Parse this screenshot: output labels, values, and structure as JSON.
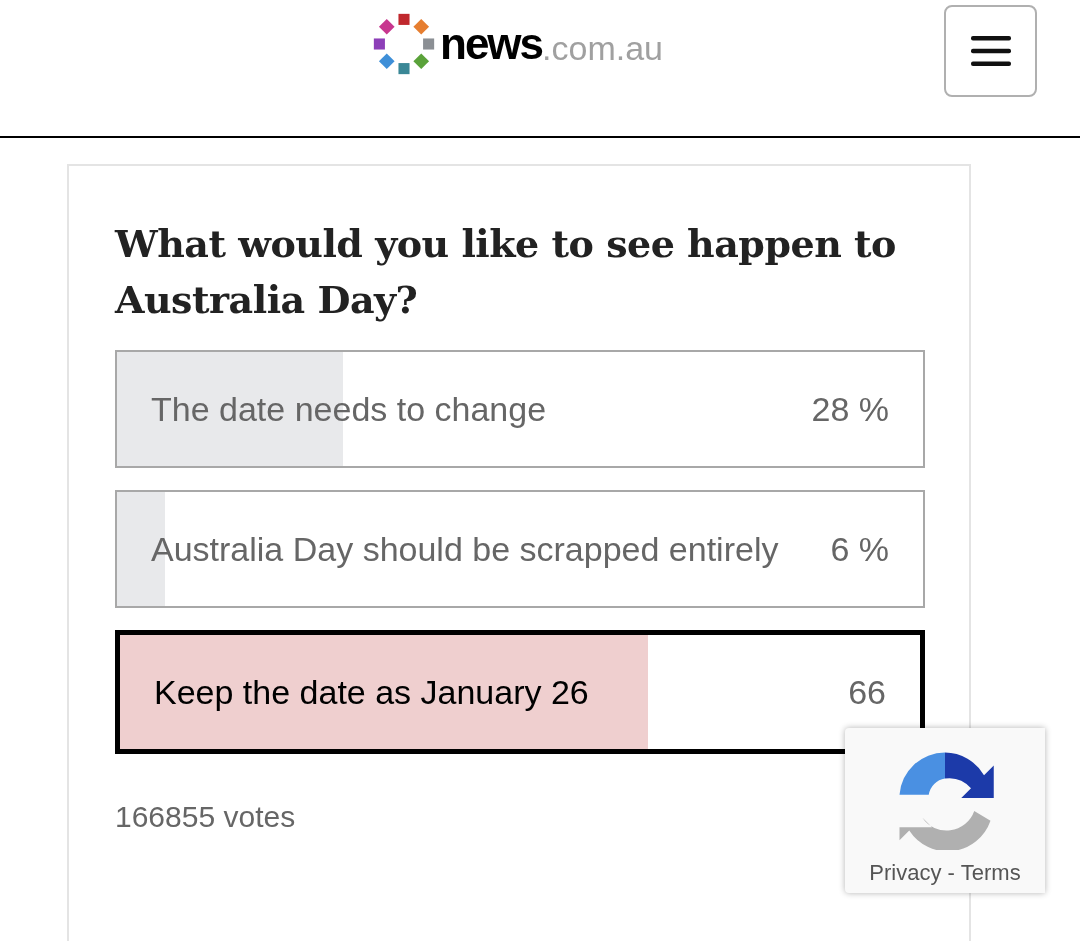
{
  "header": {
    "logo": {
      "name": "news",
      "domain": ".com.au"
    }
  },
  "poll": {
    "question": "What would you like to see happen to Australia Day?",
    "options": [
      {
        "label": "The date needs to change",
        "percent": "28 %",
        "level": 0.28,
        "selected": false
      },
      {
        "label": "Australia Day should be scrapped entirely",
        "percent": "6 %",
        "level": 0.06,
        "selected": false
      },
      {
        "label": "Keep the date as January 26",
        "percent": "66",
        "level": 0.66,
        "selected": true
      }
    ],
    "votes": "166855 votes"
  },
  "recaptcha": {
    "links": [
      "Privacy",
      "Terms"
    ],
    "separator": "-"
  }
}
